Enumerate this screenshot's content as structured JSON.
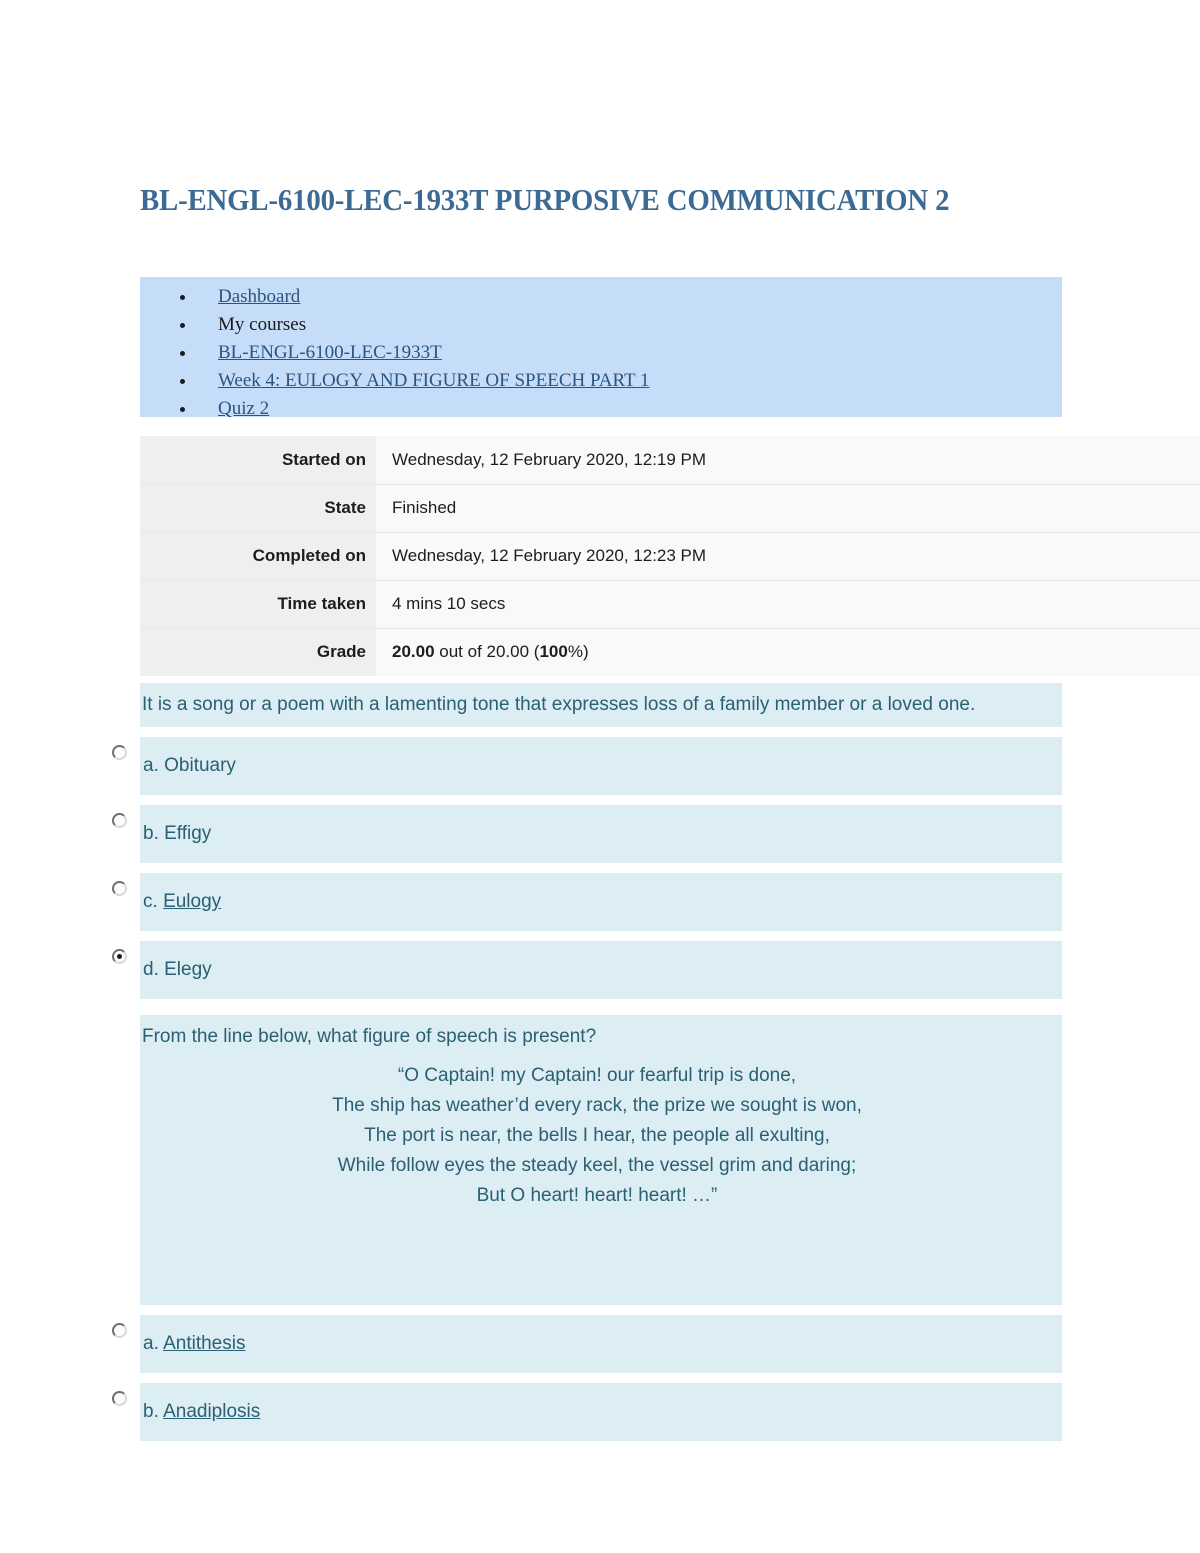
{
  "page": {
    "title": "BL-ENGL-6100-LEC-1933T PURPOSIVE COMMUNICATION 2"
  },
  "breadcrumb": {
    "items": [
      {
        "label": "Dashboard",
        "is_link": true
      },
      {
        "label": "My courses",
        "is_link": false
      },
      {
        "label": "BL-ENGL-6100-LEC-1933T",
        "is_link": true
      },
      {
        "label": "Week 4: EULOGY AND FIGURE OF SPEECH PART 1",
        "is_link": true
      },
      {
        "label": "Quiz 2",
        "is_link": true
      }
    ]
  },
  "summary": {
    "rows": [
      {
        "label": "Started on",
        "value": "Wednesday, 12 February 2020, 12:19 PM"
      },
      {
        "label": "State",
        "value": "Finished"
      },
      {
        "label": "Completed on",
        "value": "Wednesday, 12 February 2020, 12:23 PM"
      },
      {
        "label": "Time taken",
        "value": "4 mins 10 secs"
      }
    ],
    "grade": {
      "label": "Grade",
      "earned": "20.00",
      "middle": " out of 20.00 (",
      "percent": "100",
      "suffix": "%)"
    }
  },
  "questions": [
    {
      "stem": "It is a song or a poem with a lamenting tone that expresses loss of a family member or a loved one.",
      "options": [
        {
          "text": "a. Obituary",
          "selected": false,
          "link": false
        },
        {
          "text": "b. Effigy",
          "selected": false,
          "link": false
        },
        {
          "prefix": "c. ",
          "link_text": "Eulogy",
          "selected": false,
          "link": true
        },
        {
          "text": "d. Elegy",
          "selected": true,
          "link": false
        }
      ]
    },
    {
      "stem": "From the line below, what figure of speech is present?",
      "poem": [
        "“O Captain! my Captain! our fearful trip is done,",
        "The ship has weather’d every rack, the prize we sought is won,",
        "The port is near, the bells I hear, the people all exulting,",
        "While follow eyes the steady keel, the vessel grim and daring;",
        "But O heart! heart! heart! …”"
      ],
      "options": [
        {
          "prefix": "a. ",
          "link_text": "Antithesis",
          "selected": false,
          "link": true
        },
        {
          "prefix": "b. ",
          "link_text": "Anadiplosis",
          "selected": false,
          "link": true
        }
      ]
    }
  ],
  "colors": {
    "title": "#3b6a94",
    "breadcrumb_bg": "#c6ddf9",
    "question_bg": "#dcedf3",
    "question_text": "#2a6074",
    "table_label_bg": "#efefef",
    "table_value_bg": "#f9f9f9"
  }
}
